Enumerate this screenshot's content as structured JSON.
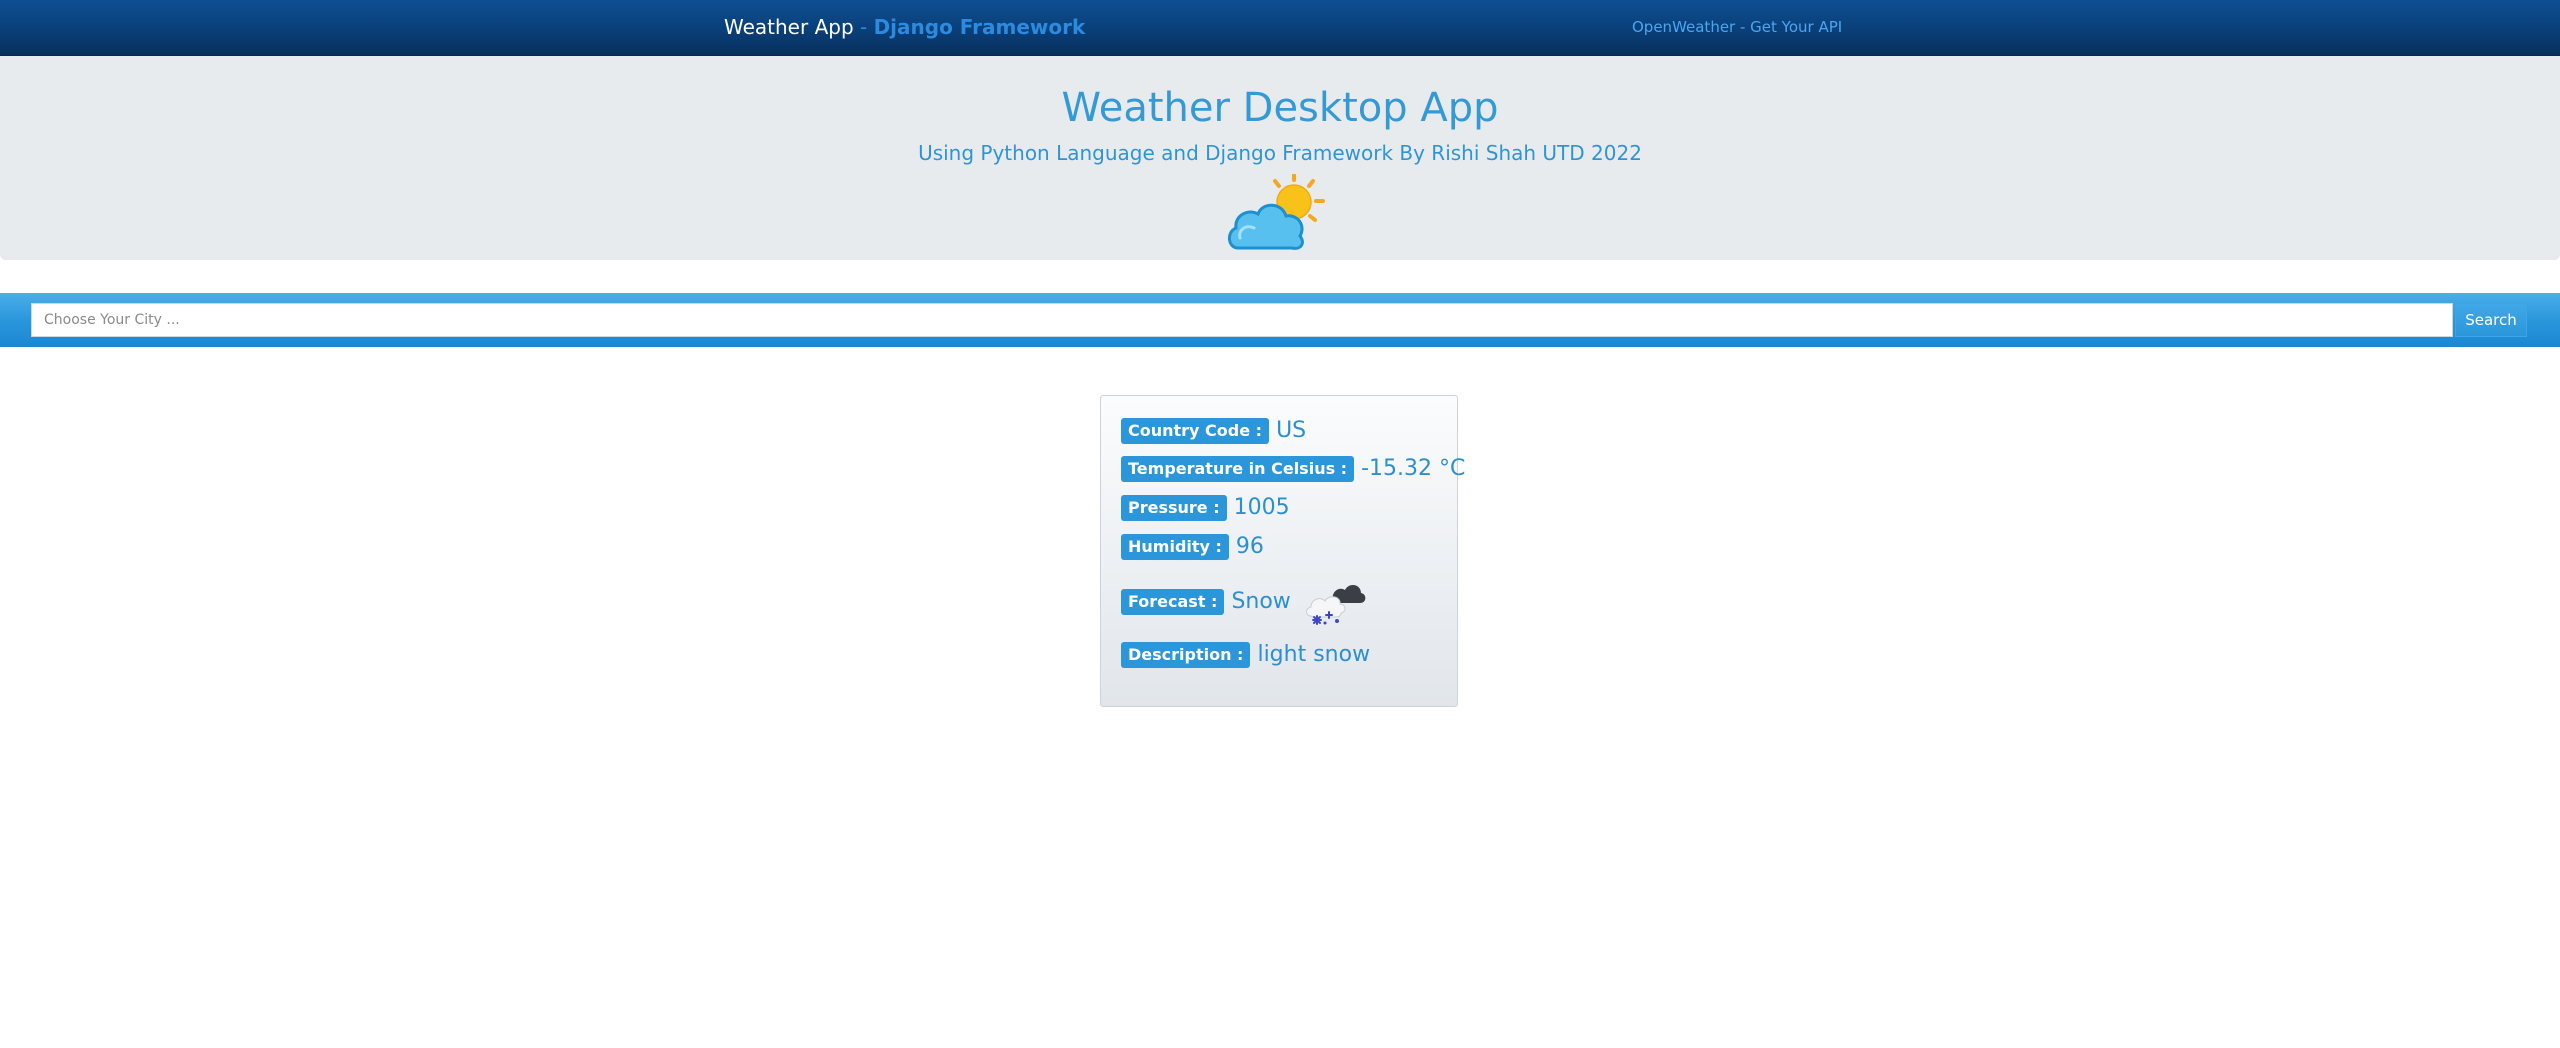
{
  "navbar": {
    "brand_main": "Weather App",
    "brand_sep": " - ",
    "brand_sub": "Django Framework",
    "link": "OpenWeather - Get Your API"
  },
  "jumbotron": {
    "title": "Weather Desktop App",
    "subtitle": "Using Python Language and Django Framework By Rishi Shah UTD 2022",
    "icon": "partly-cloudy-icon"
  },
  "search": {
    "placeholder": "Choose Your City ...",
    "value": "",
    "button_label": "Search"
  },
  "weather": {
    "country_label": "Country Code :",
    "country_value": "US",
    "temperature_label": "Temperature in Celsius :",
    "temperature_value": "-15.32 °C",
    "pressure_label": "Pressure :",
    "pressure_value": "1005",
    "humidity_label": "Humidity :",
    "humidity_value": "96",
    "forecast_label": "Forecast :",
    "forecast_value": "Snow",
    "forecast_icon": "snow-cloud-icon",
    "description_label": "Description :",
    "description_value": "light snow"
  },
  "colors": {
    "navbar": "#0a3f78",
    "accent": "#2b97da",
    "jumbotron_bg": "#e8ebee"
  }
}
